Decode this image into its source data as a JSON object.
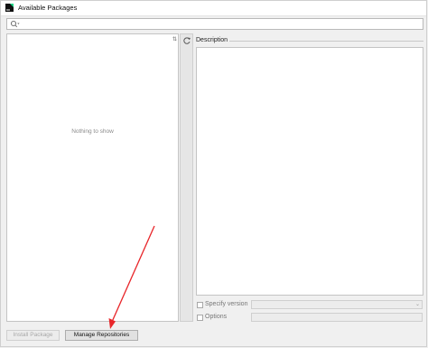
{
  "window": {
    "title": "Available Packages",
    "app_icon": "pycharm-app-icon"
  },
  "search": {
    "icon": "search-icon",
    "value": ""
  },
  "package_list": {
    "empty_message": "Nothing to show",
    "sort_icon": "sort-icon"
  },
  "toolstrip": {
    "reload_icon": "reload-icon"
  },
  "description": {
    "legend": "Description",
    "text": ""
  },
  "options": {
    "specify_version": {
      "label": "Specify version",
      "checked": false,
      "value": ""
    },
    "options": {
      "label": "Options",
      "checked": false,
      "value": ""
    }
  },
  "buttons": {
    "install": {
      "label": "Install Package",
      "enabled": false
    },
    "manage": {
      "label": "Manage Repositories",
      "enabled": true
    }
  },
  "colors": {
    "annotation_arrow": "#e8262a"
  }
}
